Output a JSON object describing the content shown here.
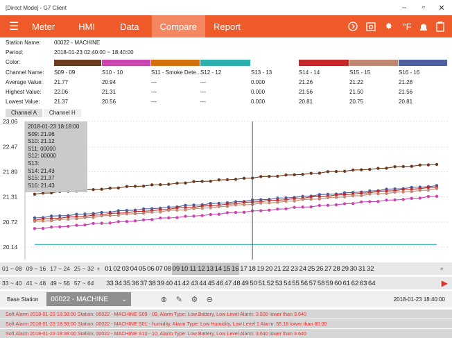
{
  "window": {
    "title": "[Direct Mode] - G7 Client"
  },
  "menu": {
    "tabs": [
      "Meter",
      "HMI",
      "Data",
      "Compare",
      "Report"
    ],
    "active": "Compare"
  },
  "toolbar_icons": [
    "timer-icon",
    "snapshot-icon",
    "brightness-icon",
    "fahrenheit-icon",
    "alarm-icon",
    "clipboard-icon"
  ],
  "temp_unit": "°F",
  "info": {
    "station_label": "Station Name:",
    "station_value": "00022 - MACHINE",
    "period_label": "Period:",
    "period_value": "2018-01-23  02:40:00 ~ 18:40:00",
    "color_label": "Color:",
    "channel_label": "Channel Name:",
    "avg_label": "Average Value:",
    "high_label": "Highest Value:",
    "low_label": "Lowest Value:"
  },
  "channels": [
    {
      "name": "S09 - 09",
      "avg": "21.77",
      "high": "22.06",
      "low": "21.37",
      "color": "#6b3b1e"
    },
    {
      "name": "S10 - 10",
      "avg": "20.94",
      "high": "21.31",
      "low": "20.56",
      "color": "#cc44b0"
    },
    {
      "name": "S11 - Smoke Dete...",
      "avg": "---",
      "high": "---",
      "low": "---",
      "color": "#d5700f"
    },
    {
      "name": "S12 - 12",
      "avg": "---",
      "high": "---",
      "low": "---",
      "color": "#2cb0b0"
    },
    {
      "name": "S13 - 13",
      "avg": "0.000",
      "high": "0.000",
      "low": "0.000",
      "color": "#ffffff"
    },
    {
      "name": "S14 - 14",
      "avg": "21.26",
      "high": "21.56",
      "low": "20.81",
      "color": "#c4282a"
    },
    {
      "name": "S15 - 15",
      "avg": "21.22",
      "high": "21.50",
      "low": "20.75",
      "color": "#c08870"
    },
    {
      "name": "S16 - 16",
      "avg": "21.28",
      "high": "21.56",
      "low": "20.81",
      "color": "#4c5f9e"
    }
  ],
  "channel_tabs": [
    "Channel A",
    "Channel H"
  ],
  "tooltip": {
    "time": "2018-01-23 18:18:00",
    "lines": [
      "S09: 21.96",
      "S10: 21.12",
      "S11: 00000",
      "S12: 00000",
      "S13:",
      "S14: 21.43",
      "S15: 21.37",
      "S16: 21.43"
    ]
  },
  "chart_data": {
    "type": "line",
    "y_ticks": [
      "23.06",
      "22.47",
      "21.89",
      "21.31",
      "20.72",
      "20.14"
    ],
    "ylim": [
      19.85,
      23.06
    ],
    "points": 49,
    "series": [
      {
        "name": "S09 - 09",
        "color": "#6b3b1e",
        "start": 21.37,
        "end": 22.06
      },
      {
        "name": "S16 - 16",
        "color": "#4c5f9e",
        "start": 20.81,
        "end": 21.56
      },
      {
        "name": "S14 - 14",
        "color": "#c4282a",
        "start": 20.76,
        "end": 21.53
      },
      {
        "name": "S15 - 15",
        "color": "#c08870",
        "start": 20.72,
        "end": 21.48
      },
      {
        "name": "S10 - 10",
        "color": "#cc44b0",
        "start": 20.56,
        "end": 21.31
      },
      {
        "name": "S12 - 12",
        "color": "#2cb0b0",
        "start": 20.2,
        "end": 20.2
      }
    ],
    "cursor_at_point": 26
  },
  "selector": {
    "groups_row1": [
      "01 ~ 08",
      "09 ~ 16",
      "17 ~ 24",
      "25 ~ 32"
    ],
    "groups_row2": [
      "33 ~ 40",
      "41 ~ 48",
      "49 ~ 56",
      "57 ~ 64"
    ],
    "plus": "+",
    "row1_numbers": [
      "01",
      "02",
      "03",
      "04",
      "05",
      "06",
      "07",
      "08",
      "09",
      "10",
      "11",
      "12",
      "13",
      "14",
      "15",
      "16",
      "17",
      "18",
      "19",
      "20",
      "21",
      "22",
      "23",
      "24",
      "25",
      "26",
      "27",
      "28",
      "29",
      "30",
      "31",
      "32"
    ],
    "row2_numbers": [
      "33",
      "34",
      "35",
      "36",
      "37",
      "38",
      "39",
      "40",
      "41",
      "42",
      "43",
      "44",
      "45",
      "46",
      "47",
      "48",
      "49",
      "50",
      "51",
      "52",
      "53",
      "54",
      "55",
      "56",
      "57",
      "58",
      "59",
      "60",
      "61",
      "62",
      "63",
      "64"
    ],
    "selected": [
      "09",
      "10",
      "11",
      "12",
      "13",
      "14",
      "15",
      "16"
    ]
  },
  "footer": {
    "base_station_label": "Base Station",
    "base_station_value": "00022 - MACHINE",
    "timestamp": "2018-01-23 18:40:00"
  },
  "alarms": [
    "Soft Alarm   2018-01-23 18:38:00   Station: 00022 - MACHINE   S09 - 09, Alarm Type: Low Battery, Low Level Alarm: 3.630 lower than 3.640",
    "Soft Alarm   2018-01-23 18:38:00   Station: 00022 - MACHINE   S01 - humidity, Alarm Type: Low Humidity, Low Level 1 Alarm: 55.18 lower than 60.00",
    "Soft Alarm   2018-01-23 18:38:00   Station: 00022 - MACHINE   S10 - 10, Alarm Type: Low Battery, Low Level Alarm: 3.640 lower than 3.640"
  ],
  "colors": {
    "accent": "#ef5a2a",
    "accent_active": "#f58662"
  }
}
